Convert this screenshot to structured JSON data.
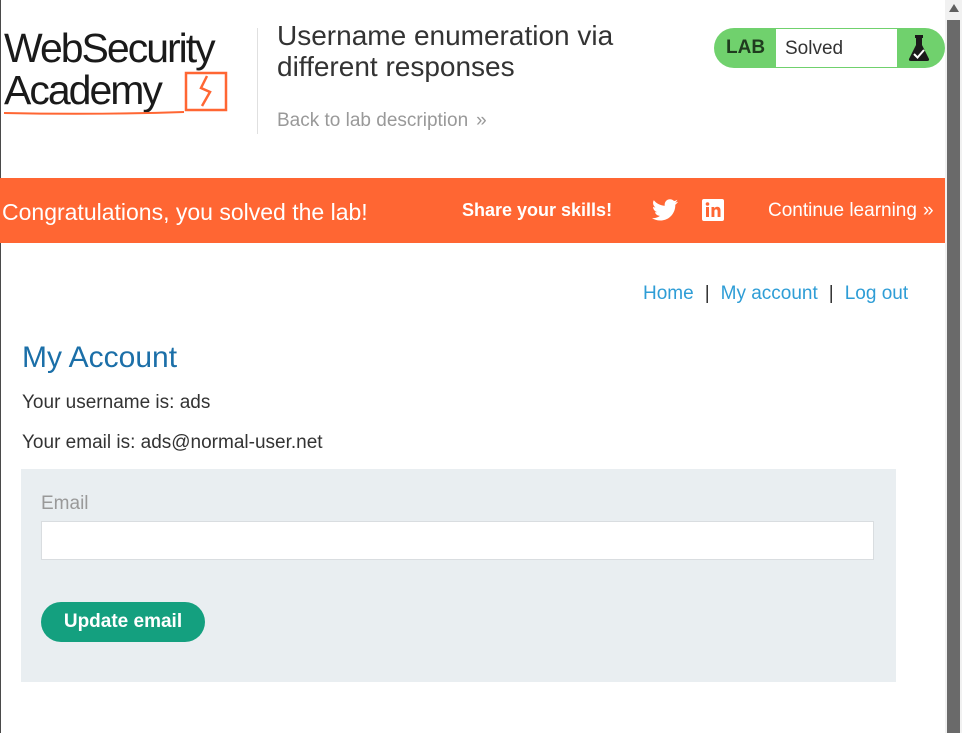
{
  "header": {
    "logo": {
      "line1": "WebSecurity",
      "line2": "Academy"
    },
    "lab_title": "Username enumeration via different responses",
    "back_link": "Back to lab description",
    "back_chevron": "»",
    "lab_status": {
      "label": "LAB",
      "status": "Solved",
      "icon": "flask-check-icon"
    }
  },
  "banner": {
    "congrats": "Congratulations, you solved the lab!",
    "share": "Share your skills!",
    "continue": "Continue learning",
    "continue_chevron": "»",
    "color": "#ff6633"
  },
  "nav": {
    "home": "Home",
    "my_account": "My account",
    "log_out": "Log out",
    "separator": "|"
  },
  "main": {
    "title": "My Account",
    "username_text": "Your username is: ads",
    "email_text": "Your email is: ads@normal-user.net",
    "form": {
      "email_label": "Email",
      "email_value": "",
      "submit": "Update email"
    }
  },
  "colors": {
    "accent_green": "#70d16d",
    "button_green": "#14a07f",
    "link_blue": "#2e9dd6",
    "title_blue": "#1b6fa8"
  }
}
